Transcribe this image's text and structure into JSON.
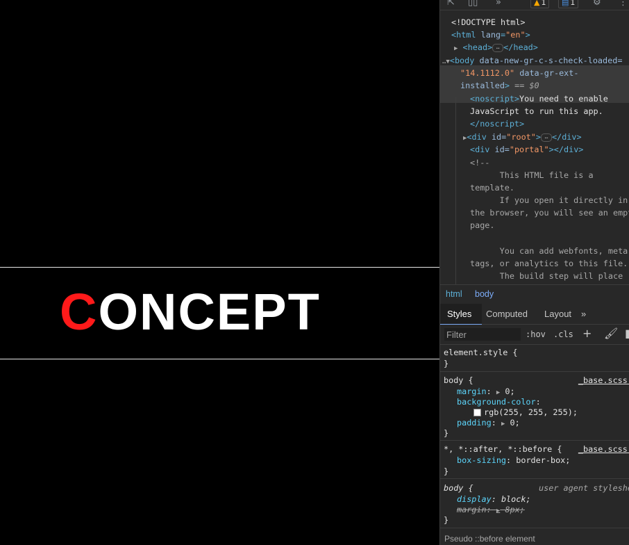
{
  "page": {
    "logo_first_letter": "C",
    "logo_rest": "ONCEPT",
    "accent_color": "#ff1a1a"
  },
  "devtools": {
    "toolbar": {
      "warnings_count": "1",
      "messages_count": "1"
    },
    "dom": {
      "doctype": "<!DOCTYPE html>",
      "html_open_tag": "<html",
      "html_lang_attr": "lang",
      "html_lang_value": "\"en\"",
      "head_open": "<head>",
      "head_close": "</head>",
      "body_open": "<body",
      "body_attr1": "data-new-gr-c-s-check-loaded=",
      "body_attr1_value": "\"14.1112.0\"",
      "body_attr2": "data-gr-ext-",
      "body_attr2_cont": "installed",
      "body_marker": "== $0",
      "noscript_open": "<noscript>",
      "noscript_text1": "You need to enable",
      "noscript_text2": "JavaScript to run this app.",
      "noscript_close": "</noscript>",
      "div_root_open": "<div",
      "div_id_attr": "id=",
      "div_root_value": "\"root\"",
      "div_close": "</div>",
      "div_portal_value": "\"portal\"",
      "comment_lines": [
        "<!--",
        "      This HTML file is a",
        "template.",
        "      If you open it directly in",
        "the browser, you will see an empty",
        "page.",
        "",
        "      You can add webfonts, meta",
        "tags, or analytics to this file.",
        "      The build step will place"
      ]
    },
    "breadcrumbs": [
      "html",
      "body"
    ],
    "tabs": [
      "Styles",
      "Computed",
      "Layout"
    ],
    "filter_placeholder": "Filter",
    "filter_buttons": {
      "hov": ":hov",
      "cls": ".cls"
    },
    "rules": {
      "element_style": "element.style {",
      "close_brace": "}",
      "body_selector": "body {",
      "body_origin": "_base.scss:",
      "body_margin_prop": "margin",
      "body_margin_val": "0;",
      "body_bg_prop": "background-color",
      "body_bg_val": "rgb(255, 255, 255);",
      "body_padding_prop": "padding",
      "body_padding_val": "0;",
      "universal_selector": "*, *::after, *::before {",
      "universal_origin": "_base.scss:",
      "box_sizing_prop": "box-sizing",
      "box_sizing_val": "border-box;",
      "ua_selector": "body {",
      "ua_origin": "user agent styleshe",
      "display_prop": "display",
      "display_val": "block;",
      "ua_margin_prop": "margin",
      "ua_margin_val": "8px;"
    },
    "pseudo_label": "Pseudo ::before element"
  }
}
